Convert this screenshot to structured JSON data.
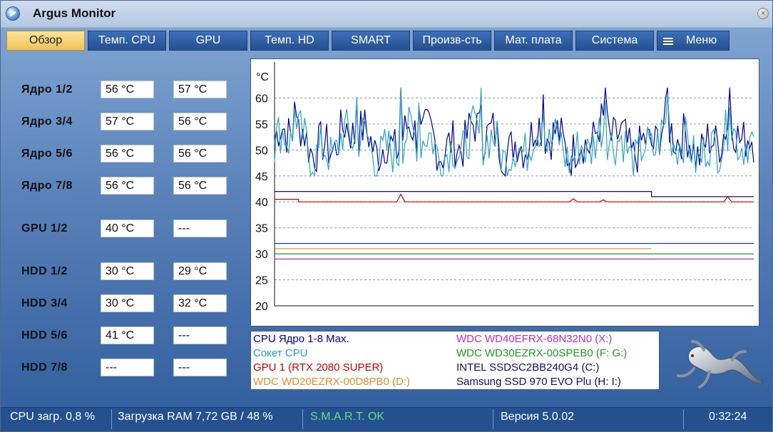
{
  "window": {
    "title": "Argus Monitor"
  },
  "tabs": [
    {
      "label": "Обзор",
      "active": true
    },
    {
      "label": "Темп. CPU"
    },
    {
      "label": "GPU"
    },
    {
      "label": "Темп. HD"
    },
    {
      "label": "SMART"
    },
    {
      "label": "Произв-сть"
    },
    {
      "label": "Мат. плата"
    },
    {
      "label": "Система"
    },
    {
      "label": "Меню",
      "icon": "hamburger-menu-icon"
    }
  ],
  "sensors": [
    {
      "label": "Ядро 1/2",
      "v1": "56 °C",
      "v2": "57 °C"
    },
    {
      "label": "Ядро 3/4",
      "v1": "57 °C",
      "v2": "56 °C"
    },
    {
      "label": "Ядро 5/6",
      "v1": "56 °C",
      "v2": "56 °C"
    },
    {
      "label": "Ядро 7/8",
      "v1": "56 °C",
      "v2": "56 °C"
    },
    {
      "label": "GPU 1/2",
      "v1": "40 °C",
      "v2": "---"
    },
    {
      "label": "HDD 1/2",
      "v1": "30 °C",
      "v2": "29 °C"
    },
    {
      "label": "HDD 3/4",
      "v1": "30 °C",
      "v2": "32 °C"
    },
    {
      "label": "HDD 5/6",
      "v1": "41 °C",
      "v2": "---"
    },
    {
      "label": "HDD 7/8",
      "v1": "---",
      "v2": "---"
    }
  ],
  "chart_data": {
    "type": "line",
    "ylabel": "°C",
    "ylim": [
      20,
      65
    ],
    "yticks": [
      20,
      25,
      30,
      35,
      40,
      45,
      50,
      55,
      60
    ],
    "grid": true,
    "x_count": 240,
    "series": [
      {
        "name": "CPU Ядро 1-8 Max.",
        "color": "#0000a0",
        "level": 52,
        "variation": "high"
      },
      {
        "name": "Сокет CPU",
        "color": "#2aa8c4",
        "level": 51,
        "variation": "high"
      },
      {
        "name": "GPU 1 (RTX 2080 SUPER)",
        "color": "#dd0000",
        "segments": [
          {
            "from": 0,
            "to": 12,
            "value": 40.5
          },
          {
            "from": 12,
            "to": 240,
            "value": 40
          }
        ],
        "spikes": [
          {
            "at": 63,
            "value": 41.5
          },
          {
            "at": 149,
            "value": 40.6
          },
          {
            "at": 164,
            "value": 40.4
          },
          {
            "at": 226,
            "value": 41
          }
        ]
      },
      {
        "name": "WDC WD20EZRX-00D8PB0 (D:)",
        "color": "#ef8b2c",
        "segments": [
          {
            "from": 0,
            "to": 188,
            "value": 31
          }
        ]
      },
      {
        "name": "WDC WD40EFRX-68N32N0 (X:)",
        "color": "#c030c8",
        "segments": [
          {
            "from": 0,
            "to": 240,
            "value": 29
          }
        ]
      },
      {
        "name": "WDC WD30EZRX-00SPEB0 (F: G:)",
        "color": "#20a020",
        "segments": [
          {
            "from": 0,
            "to": 240,
            "value": 30
          }
        ]
      },
      {
        "name": "INTEL SSDSC2BB240G4 (C:)",
        "color": "#101070",
        "segments": [
          {
            "from": 0,
            "to": 188,
            "value": 42
          },
          {
            "from": 188,
            "to": 240,
            "value": 41
          }
        ]
      },
      {
        "name": "Samsung SSD 970 EVO Plu (H: I:)",
        "color": "#1a3ccc",
        "segments": [
          {
            "from": 0,
            "to": 240,
            "value": 32
          }
        ]
      }
    ]
  },
  "legend": {
    "left": [
      {
        "label": "CPU Ядро 1-8 Max.",
        "color": "#0000b0"
      },
      {
        "label": "Сокет CPU",
        "color": "#20a0d0"
      },
      {
        "label": "GPU 1 (RTX 2080 SUPER)",
        "color": "#dd0000"
      },
      {
        "label": "WDC WD20EZRX-00D8PB0 (D:)",
        "color": "#ef8b2c"
      }
    ],
    "right": [
      {
        "label": "WDC WD40EFRX-68N32N0 (X:)",
        "color": "#c030c8"
      },
      {
        "label": "WDC WD30EZRX-00SPEB0 (F: G:)",
        "color": "#20a020"
      },
      {
        "label": "INTEL SSDSC2BB240G4 (C:)",
        "color": "#101070"
      },
      {
        "label": "Samsung SSD 970 EVO Plu (H: I:)",
        "color": "#101070"
      }
    ]
  },
  "status": {
    "cpu_load": "CPU загр. 0,8 %",
    "ram_load": "Загрузка RAM 7,72 GB / 48 %",
    "smart": "S.M.A.R.T. OK",
    "smart_color": "#5ee07a",
    "version": "Версия 5.0.02",
    "time": "0:32:24"
  },
  "icons": {
    "app": "argus-app-icon",
    "close": "close-icon",
    "logo": "lizard-logo-icon"
  }
}
